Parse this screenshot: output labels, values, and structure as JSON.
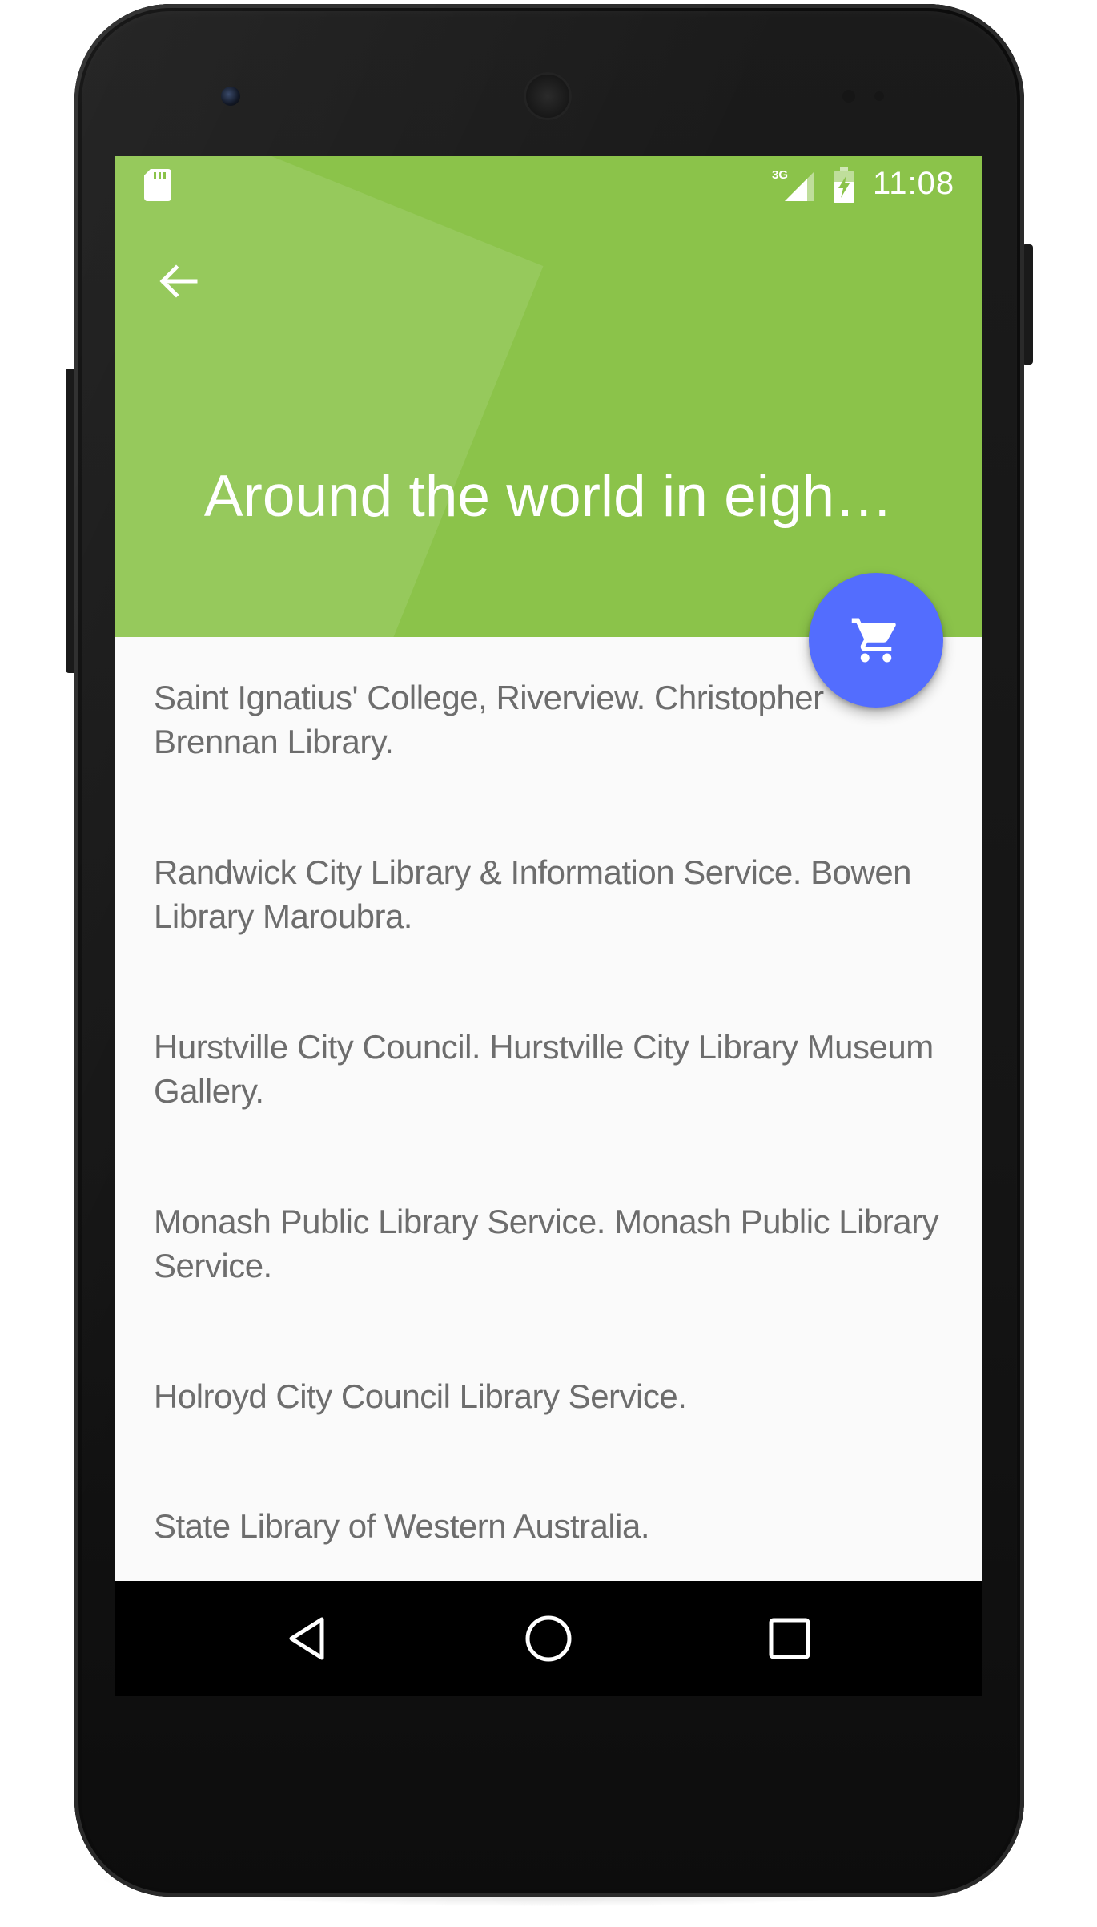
{
  "status_bar": {
    "network_label": "3G",
    "time": "11:08"
  },
  "app_bar": {
    "title": "Around the world in eigh…",
    "color": "#8bc34a"
  },
  "fab": {
    "icon": "cart-icon",
    "color": "#536dfe"
  },
  "libraries": [
    {
      "text": "Saint Ignatius' College, Riverview. Christopher Brennan Library."
    },
    {
      "text": "Randwick City Library & Information Service. Bowen Library Maroubra."
    },
    {
      "text": "Hurstville City Council. Hurstville City Library Museum Gallery."
    },
    {
      "text": "Monash Public Library Service. Monash Public Library Service."
    },
    {
      "text": "Holroyd City Council Library Service."
    },
    {
      "text": "State Library of Western Australia."
    }
  ],
  "nav_bar": {
    "buttons": [
      "back-nav-icon",
      "home-nav-icon",
      "recents-nav-icon"
    ]
  }
}
